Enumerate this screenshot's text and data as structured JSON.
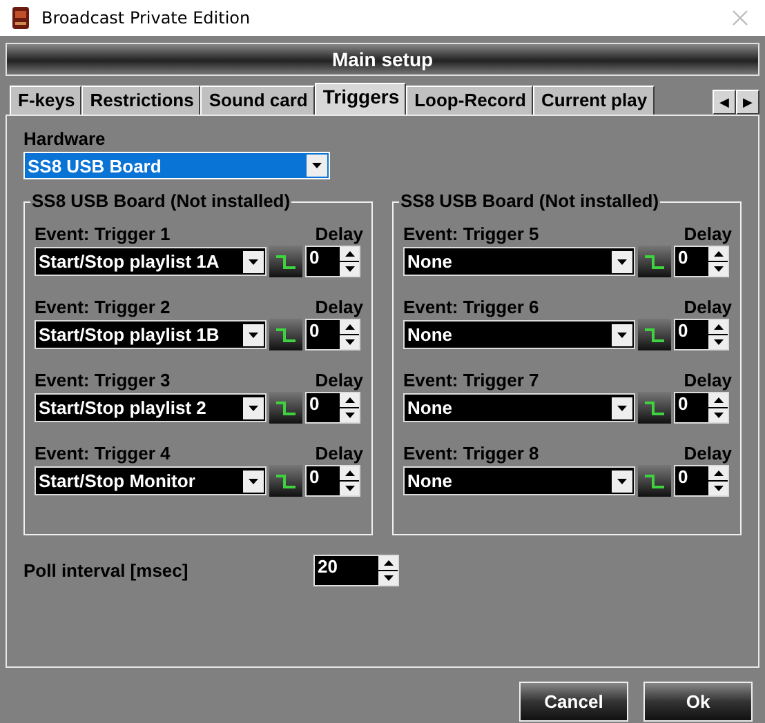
{
  "window": {
    "title": "Broadcast Private Edition"
  },
  "header": {
    "title": "Main setup"
  },
  "tabs": [
    {
      "label": "F-keys",
      "selected": false
    },
    {
      "label": "Restrictions",
      "selected": false
    },
    {
      "label": "Sound card",
      "selected": false
    },
    {
      "label": "Triggers",
      "selected": true
    },
    {
      "label": "Loop-Record",
      "selected": false
    },
    {
      "label": "Current play",
      "selected": false
    }
  ],
  "tab_scroll": [
    "◀",
    "▶"
  ],
  "hardware": {
    "label": "Hardware",
    "value": "SS8 USB Board"
  },
  "groups": [
    {
      "title": "SS8 USB Board (Not installed)",
      "triggers": [
        {
          "label": "Event: Trigger 1",
          "event": "Start/Stop playlist 1A",
          "delay_label": "Delay",
          "delay": "0"
        },
        {
          "label": "Event: Trigger 2",
          "event": "Start/Stop playlist 1B",
          "delay_label": "Delay",
          "delay": "0"
        },
        {
          "label": "Event: Trigger 3",
          "event": "Start/Stop playlist 2",
          "delay_label": "Delay",
          "delay": "0"
        },
        {
          "label": "Event: Trigger 4",
          "event": "Start/Stop Monitor",
          "delay_label": "Delay",
          "delay": "0"
        }
      ]
    },
    {
      "title": "SS8 USB Board (Not installed)",
      "triggers": [
        {
          "label": "Event: Trigger 5",
          "event": "None",
          "delay_label": "Delay",
          "delay": "0"
        },
        {
          "label": "Event: Trigger 6",
          "event": "None",
          "delay_label": "Delay",
          "delay": "0"
        },
        {
          "label": "Event: Trigger 7",
          "event": "None",
          "delay_label": "Delay",
          "delay": "0"
        },
        {
          "label": "Event: Trigger 8",
          "event": "None",
          "delay_label": "Delay",
          "delay": "0"
        }
      ]
    }
  ],
  "poll": {
    "label": "Poll interval [msec]",
    "value": "20"
  },
  "buttons": [
    "Cancel",
    "Ok"
  ]
}
